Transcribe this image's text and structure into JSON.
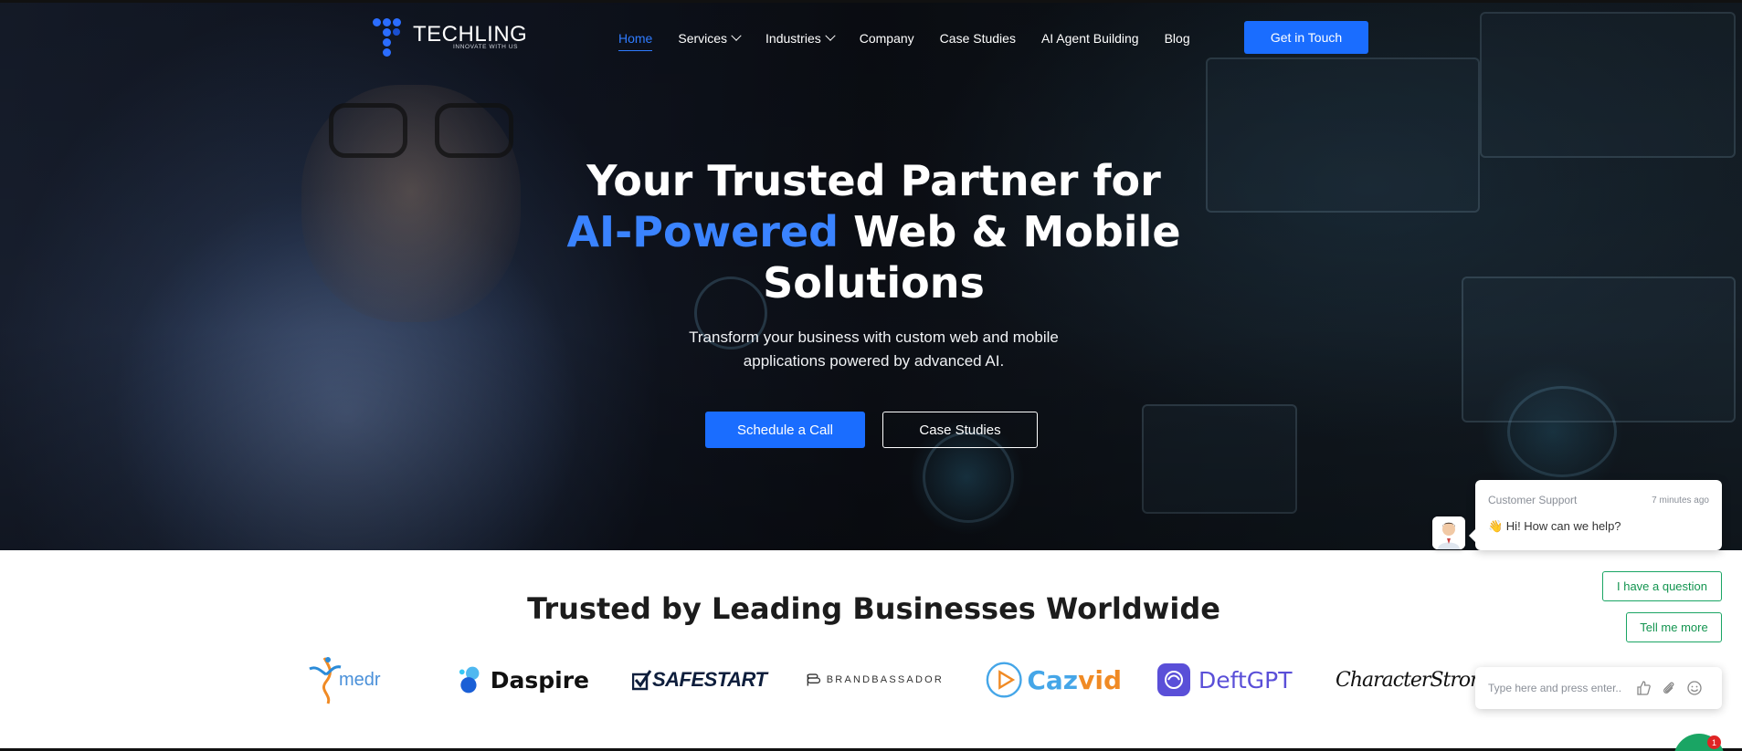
{
  "nav": {
    "logo_text": "TECHLING",
    "logo_tagline": "INNOVATE WITH US",
    "items": [
      {
        "label": "Home",
        "active": true,
        "dropdown": false
      },
      {
        "label": "Services",
        "active": false,
        "dropdown": true
      },
      {
        "label": "Industries",
        "active": false,
        "dropdown": true
      },
      {
        "label": "Company",
        "active": false,
        "dropdown": false
      },
      {
        "label": "Case Studies",
        "active": false,
        "dropdown": false
      },
      {
        "label": "AI Agent Building",
        "active": false,
        "dropdown": false
      },
      {
        "label": "Blog",
        "active": false,
        "dropdown": false
      }
    ],
    "cta_label": "Get in Touch"
  },
  "hero": {
    "title_line1": "Your Trusted Partner for",
    "title_accent": "AI-Powered",
    "title_line2_rest": " Web & Mobile",
    "title_line3": "Solutions",
    "subtitle_line1": "Transform your business with custom web and mobile",
    "subtitle_line2": "applications powered by advanced AI.",
    "primary_button": "Schedule a Call",
    "secondary_button": "Case Studies"
  },
  "trusted": {
    "title": "Trusted by Leading Businesses Worldwide",
    "brands": [
      "medr",
      "Daspire",
      "SAFESTART",
      "BRANDBASSADOR",
      "Cazvid",
      "DeftGPT",
      "CharacterStrong"
    ]
  },
  "chat": {
    "from": "Customer Support",
    "time": "7 minutes ago",
    "message": "👋 Hi! How can we help?",
    "quick_replies": [
      "I have a question",
      "Tell me more"
    ],
    "input_placeholder": "Type here and press enter..",
    "badge_count": "1"
  },
  "colors": {
    "accent_blue": "#1a6dff",
    "chat_green": "#1aa564",
    "heading_dark": "#1c1c1c"
  }
}
